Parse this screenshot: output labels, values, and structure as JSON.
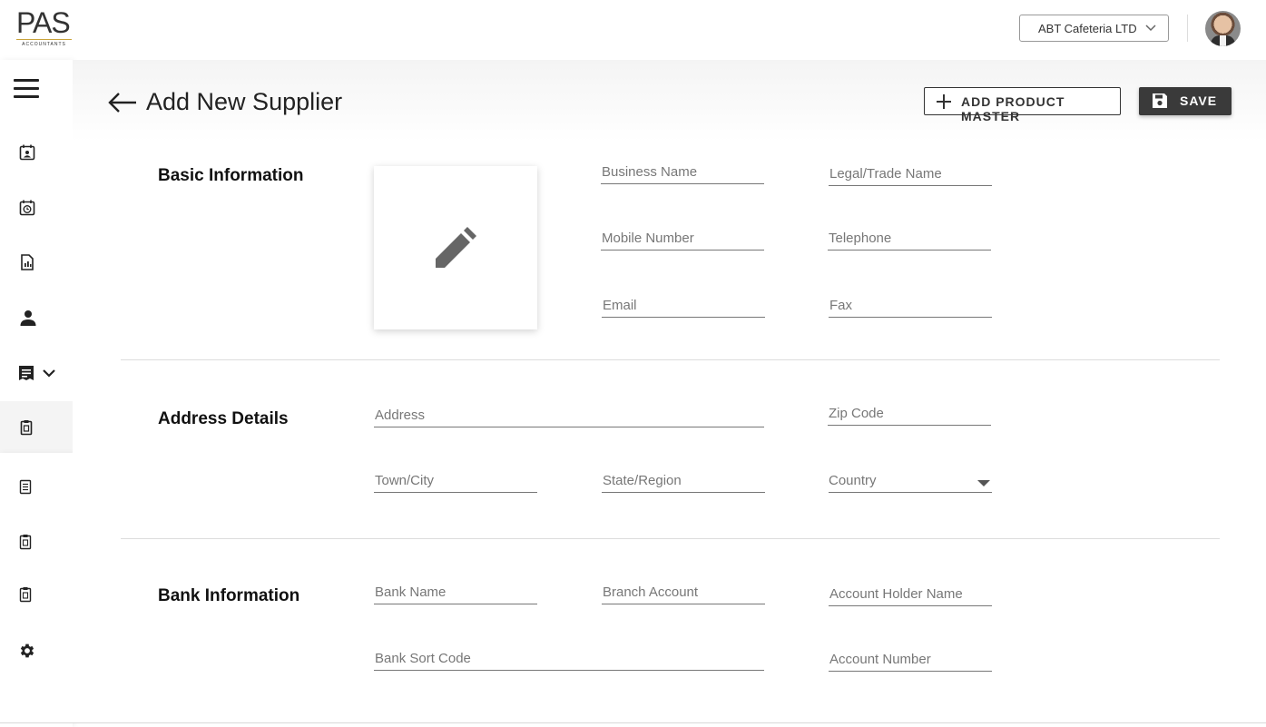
{
  "header": {
    "logo_text": "PAS",
    "logo_subtext": "ACCOUNTANTS",
    "company_selected": "ABT Cafeteria LTD"
  },
  "sidebar": {
    "items": [
      {
        "icon": "calendar-person-icon"
      },
      {
        "icon": "calendar-clock-icon"
      },
      {
        "icon": "report-chart-icon"
      },
      {
        "icon": "person-icon"
      },
      {
        "icon": "receipt-icon",
        "expanded": true
      },
      {
        "icon": "clipboard-icon"
      },
      {
        "icon": "clipboard-list-icon"
      },
      {
        "icon": "clipboard-icon"
      },
      {
        "icon": "clipboard-icon"
      },
      {
        "icon": "gear-icon"
      }
    ]
  },
  "page": {
    "title": "Add New Supplier",
    "add_product_master_label": "ADD PRODUCT MASTER",
    "save_label": "SAVE"
  },
  "sections": {
    "basic": {
      "title": "Basic Information",
      "business_name": "Business Name",
      "legal_trade_name": "Legal/Trade Name",
      "mobile_number": "Mobile Number",
      "telephone": "Telephone",
      "email": "Email",
      "fax": "Fax"
    },
    "address": {
      "title": "Address Details",
      "address": "Address",
      "zip_code": "Zip Code",
      "town_city": "Town/City",
      "state_region": "State/Region",
      "country": "Country"
    },
    "bank": {
      "title": "Bank Information",
      "bank_name": "Bank Name",
      "branch_account": "Branch Account",
      "account_holder_name": "Account Holder Name",
      "bank_sort_code": "Bank Sort Code",
      "account_number": "Account Number"
    }
  }
}
